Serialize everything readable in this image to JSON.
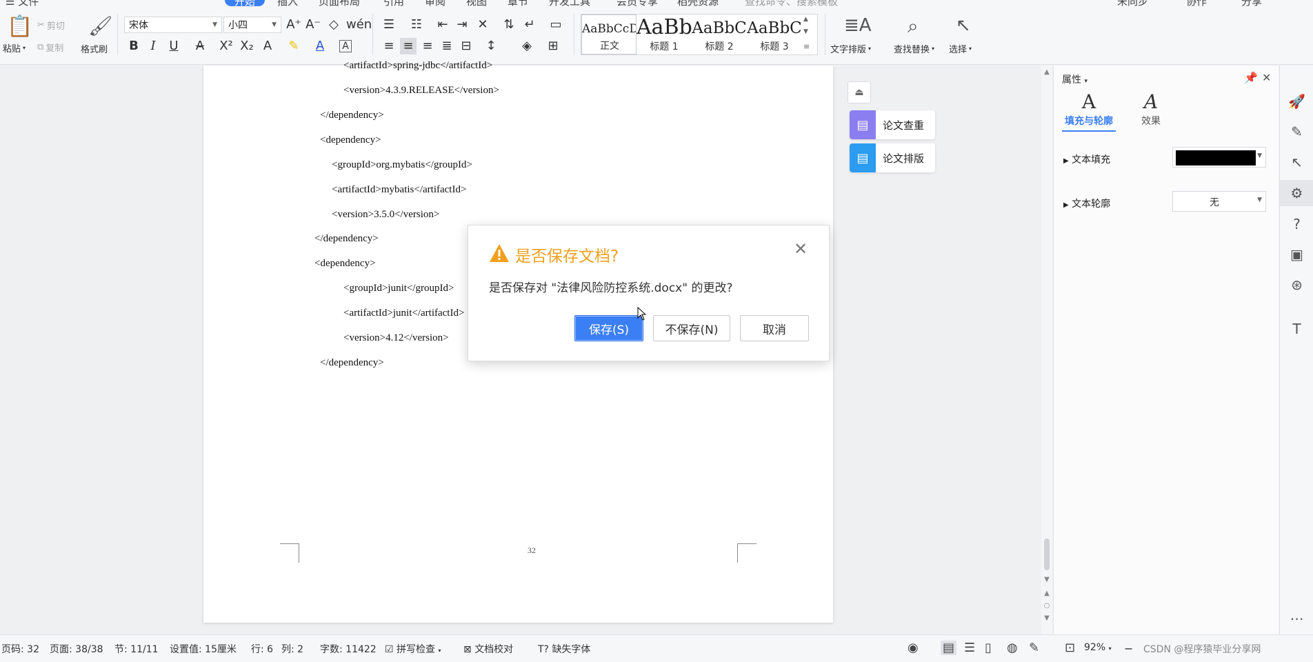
{
  "ribbon": {
    "tabs": [
      {
        "label": "开始",
        "active": true
      },
      {
        "label": "插入"
      },
      {
        "label": "页面布局"
      },
      {
        "label": "引用"
      },
      {
        "label": "审阅"
      },
      {
        "label": "视图"
      },
      {
        "label": "章节"
      },
      {
        "label": "开发工具"
      },
      {
        "label": "会员专享"
      },
      {
        "label": "稻壳资源"
      }
    ],
    "search_placeholder": "查找命令、搜索模板",
    "top_right": [
      "未同步",
      "协作",
      "分享"
    ],
    "clipboard": {
      "paste": "粘贴",
      "cut": "剪切",
      "copy": "复制",
      "format_painter": "格式刷"
    },
    "font_name": "宋体",
    "font_size": "小四",
    "styles": [
      {
        "preview": "AaBbCcDd",
        "name": "正文"
      },
      {
        "preview": "AaBb",
        "name": "标题 1"
      },
      {
        "preview": "AaBbC",
        "name": "标题 2"
      },
      {
        "preview": "AaBbC",
        "name": "标题 3"
      }
    ],
    "text_layout": "文字排版",
    "find_replace": "查找替换",
    "select": "选择"
  },
  "document": {
    "code_lines": [
      "<artifactId>spring-jdbc</artifactId>",
      "<version>4.3.9.RELEASE</version>",
      "</dependency>",
      "<dependency>",
      "<groupId>org.mybatis</groupId>",
      "<artifactId>mybatis</artifactId>",
      "<version>3.5.0</version>",
      "</dependency>",
      "<dependency>",
      "<groupId>junit</groupId>",
      "<artifactId>junit</artifactId>",
      "<version>4.12</version>",
      "</dependency>"
    ],
    "page_number": "32"
  },
  "side_tools": {
    "thesis_check": "论文查重",
    "thesis_format": "论文排版"
  },
  "properties": {
    "title": "属性",
    "tab_fill": "填充与轮廓",
    "tab_effect": "效果",
    "text_fill_label": "文本填充",
    "text_fill_color": "#000000",
    "text_outline_label": "文本轮廓",
    "text_outline_value": "无"
  },
  "dialog": {
    "title": "是否保存文档?",
    "message": "是否保存对 \"法律风险防控系统.docx\" 的更改?",
    "save": "保存(S)",
    "dont_save": "不保存(N)",
    "cancel": "取消"
  },
  "status": {
    "page_code": "页码: 32",
    "pages": "页面: 38/38",
    "section": "节: 11/11",
    "setting": "设置值: 15厘米",
    "row": "行: 6",
    "col": "列: 2",
    "words": "字数: 11422",
    "spell_check": "拼写检查",
    "doc_proof": "文档校对",
    "missing_font": "缺失字体",
    "zoom": "92%",
    "watermark": "CSDN @程序猿毕业分享网"
  },
  "colors": {
    "accent": "#3b7ff5",
    "warning": "#f0a01e"
  }
}
